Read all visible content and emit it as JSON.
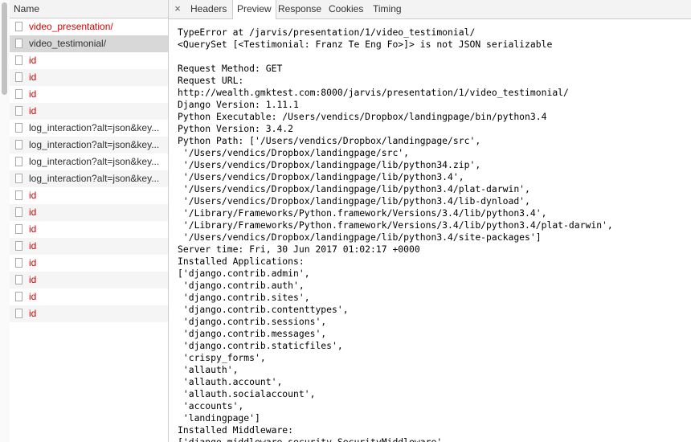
{
  "request_list": {
    "header": "Name",
    "items": [
      {
        "name": "video_presentation/",
        "status": "error"
      },
      {
        "name": "video_testimonial/",
        "status": "normal",
        "selected": true
      },
      {
        "name": "id",
        "status": "error"
      },
      {
        "name": "id",
        "status": "error"
      },
      {
        "name": "id",
        "status": "error"
      },
      {
        "name": "id",
        "status": "error"
      },
      {
        "name": "log_interaction?alt=json&key...",
        "status": "normal"
      },
      {
        "name": "log_interaction?alt=json&key...",
        "status": "normal"
      },
      {
        "name": "log_interaction?alt=json&key...",
        "status": "normal"
      },
      {
        "name": "log_interaction?alt=json&key...",
        "status": "normal"
      },
      {
        "name": "id",
        "status": "error"
      },
      {
        "name": "id",
        "status": "error"
      },
      {
        "name": "id",
        "status": "error"
      },
      {
        "name": "id",
        "status": "error"
      },
      {
        "name": "id",
        "status": "error"
      },
      {
        "name": "id",
        "status": "error"
      },
      {
        "name": "id",
        "status": "error"
      },
      {
        "name": "id",
        "status": "error"
      }
    ]
  },
  "detail_tabs": {
    "close": "×",
    "tabs": [
      "Headers",
      "Preview",
      "Response",
      "Cookies",
      "Timing"
    ],
    "active": "Preview"
  },
  "preview": {
    "lines": [
      "TypeError at /jarvis/presentation/1/video_testimonial/",
      "<QuerySet [<Testimonial: Franz Te Eng Fo>]> is not JSON serializable",
      "",
      "Request Method: GET",
      "Request URL:",
      "http://wealth.gmktest.com:8000/jarvis/presentation/1/video_testimonial/",
      "Django Version: 1.11.1",
      "Python Executable: /Users/vendics/Dropbox/landingpage/bin/python3.4",
      "Python Version: 3.4.2",
      "Python Path: ['/Users/vendics/Dropbox/landingpage/src',",
      " '/Users/vendics/Dropbox/landingpage/src',",
      " '/Users/vendics/Dropbox/landingpage/lib/python34.zip',",
      " '/Users/vendics/Dropbox/landingpage/lib/python3.4',",
      " '/Users/vendics/Dropbox/landingpage/lib/python3.4/plat-darwin',",
      " '/Users/vendics/Dropbox/landingpage/lib/python3.4/lib-dynload',",
      " '/Library/Frameworks/Python.framework/Versions/3.4/lib/python3.4',",
      " '/Library/Frameworks/Python.framework/Versions/3.4/lib/python3.4/plat-darwin',",
      " '/Users/vendics/Dropbox/landingpage/lib/python3.4/site-packages']",
      "Server time: Fri, 30 Jun 2017 01:02:17 +0000",
      "Installed Applications:",
      "['django.contrib.admin',",
      " 'django.contrib.auth',",
      " 'django.contrib.sites',",
      " 'django.contrib.contenttypes',",
      " 'django.contrib.sessions',",
      " 'django.contrib.messages',",
      " 'django.contrib.staticfiles',",
      " 'crispy_forms',",
      " 'allauth',",
      " 'allauth.account',",
      " 'allauth.socialaccount',",
      " 'accounts',",
      " 'landingpage']",
      "Installed Middleware:",
      "['django.middleware.security.SecurityMiddleware',"
    ]
  },
  "colors": {
    "error_text": "#e00000",
    "header_bg": "#f3f3f3",
    "selected_row": "#d8d8d8",
    "striped_row": "#f5f5f5"
  }
}
